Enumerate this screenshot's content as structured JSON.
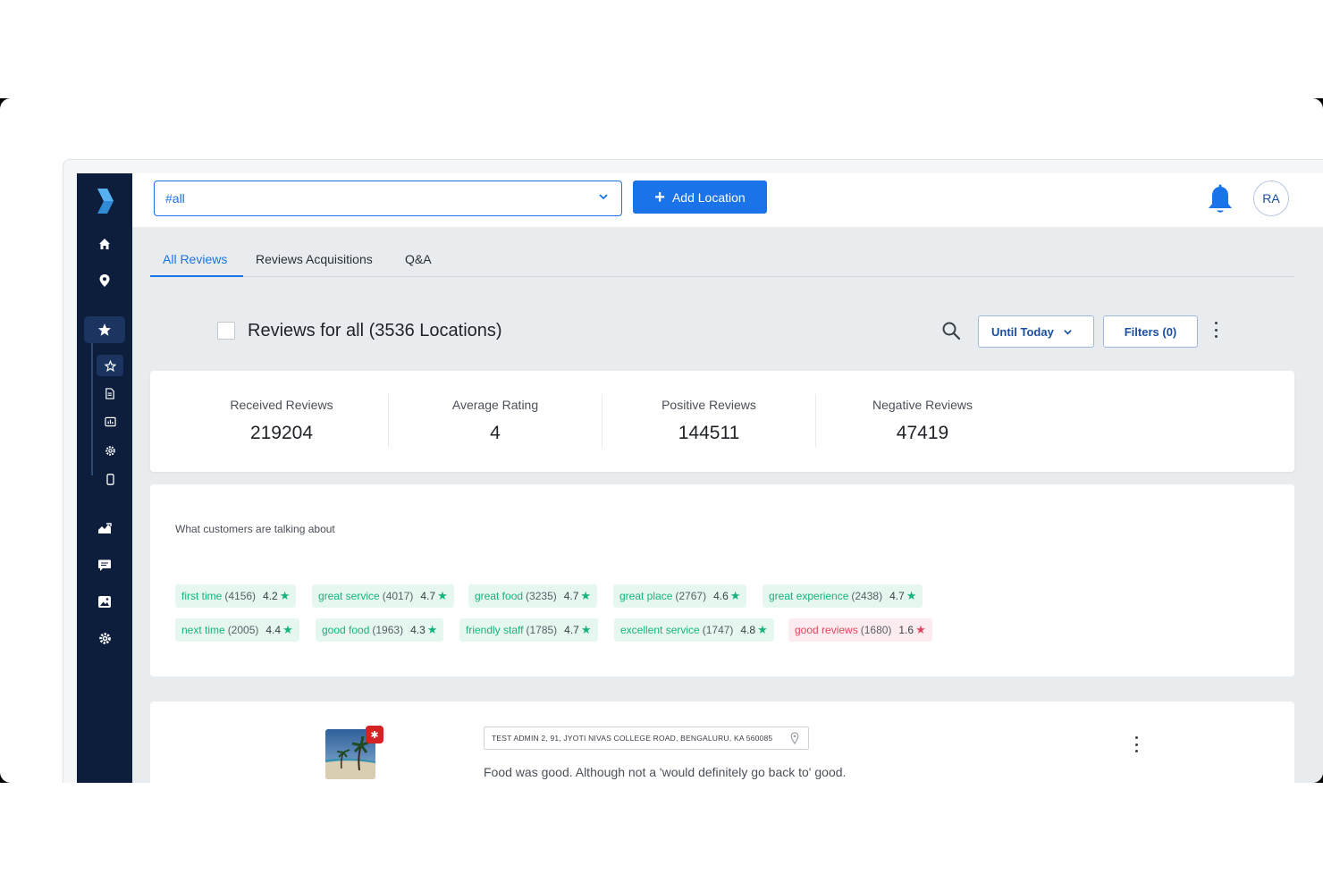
{
  "topbar": {
    "location_value": "#all",
    "add_location_label": "Add Location",
    "avatar_initials": "RA"
  },
  "tabs": [
    {
      "label": "All Reviews",
      "active": true
    },
    {
      "label": "Reviews Acquisitions",
      "active": false
    },
    {
      "label": "Q&A",
      "active": false
    }
  ],
  "reviews_header": {
    "title": "Reviews for all (3536 Locations)",
    "date_filter_label": "Until Today",
    "filters_label": "Filters (0)"
  },
  "stats": [
    {
      "label": "Received Reviews",
      "value": "219204"
    },
    {
      "label": "Average Rating",
      "value": "4"
    },
    {
      "label": "Positive Reviews",
      "value": "144511"
    },
    {
      "label": "Negative Reviews",
      "value": "47419"
    }
  ],
  "topics": {
    "title": "What customers are talking about",
    "chips": [
      {
        "term": "first time",
        "count": "(4156)",
        "rating": "4.2",
        "sentiment": "positive"
      },
      {
        "term": "great service",
        "count": "(4017)",
        "rating": "4.7",
        "sentiment": "positive"
      },
      {
        "term": "great food",
        "count": "(3235)",
        "rating": "4.7",
        "sentiment": "positive"
      },
      {
        "term": "great place",
        "count": "(2767)",
        "rating": "4.6",
        "sentiment": "positive"
      },
      {
        "term": "great experience",
        "count": "(2438)",
        "rating": "4.7",
        "sentiment": "positive"
      },
      {
        "term": "next time",
        "count": "(2005)",
        "rating": "4.4",
        "sentiment": "positive"
      },
      {
        "term": "good food",
        "count": "(1963)",
        "rating": "4.3",
        "sentiment": "positive"
      },
      {
        "term": "friendly staff",
        "count": "(1785)",
        "rating": "4.7",
        "sentiment": "positive"
      },
      {
        "term": "excellent service",
        "count": "(1747)",
        "rating": "4.8",
        "sentiment": "positive"
      },
      {
        "term": "good reviews",
        "count": "(1680)",
        "rating": "1.6",
        "sentiment": "negative"
      }
    ]
  },
  "review": {
    "address": "TEST ADMIN 2, 91, JYOTI NIVAS COLLEGE ROAD, BENGALURU, KA 560085",
    "text": "Food was good. Although not a 'would definitely go back to' good. Ordered",
    "source_icon": "yelp-icon"
  },
  "sidebar": {
    "items": [
      "home-icon",
      "location-pin-icon",
      "star-icon",
      "analytics-icon",
      "chat-icon",
      "photos-icon",
      "settings-icon"
    ],
    "sub_items": [
      "star-outline-icon",
      "document-icon",
      "report-icon",
      "gear-icon",
      "mobile-icon"
    ]
  },
  "colors": {
    "brand_blue": "#1a73e8",
    "sidebar_bg": "#0c1e3c",
    "positive_green": "#16b37e",
    "negative_red": "#e2475f"
  }
}
